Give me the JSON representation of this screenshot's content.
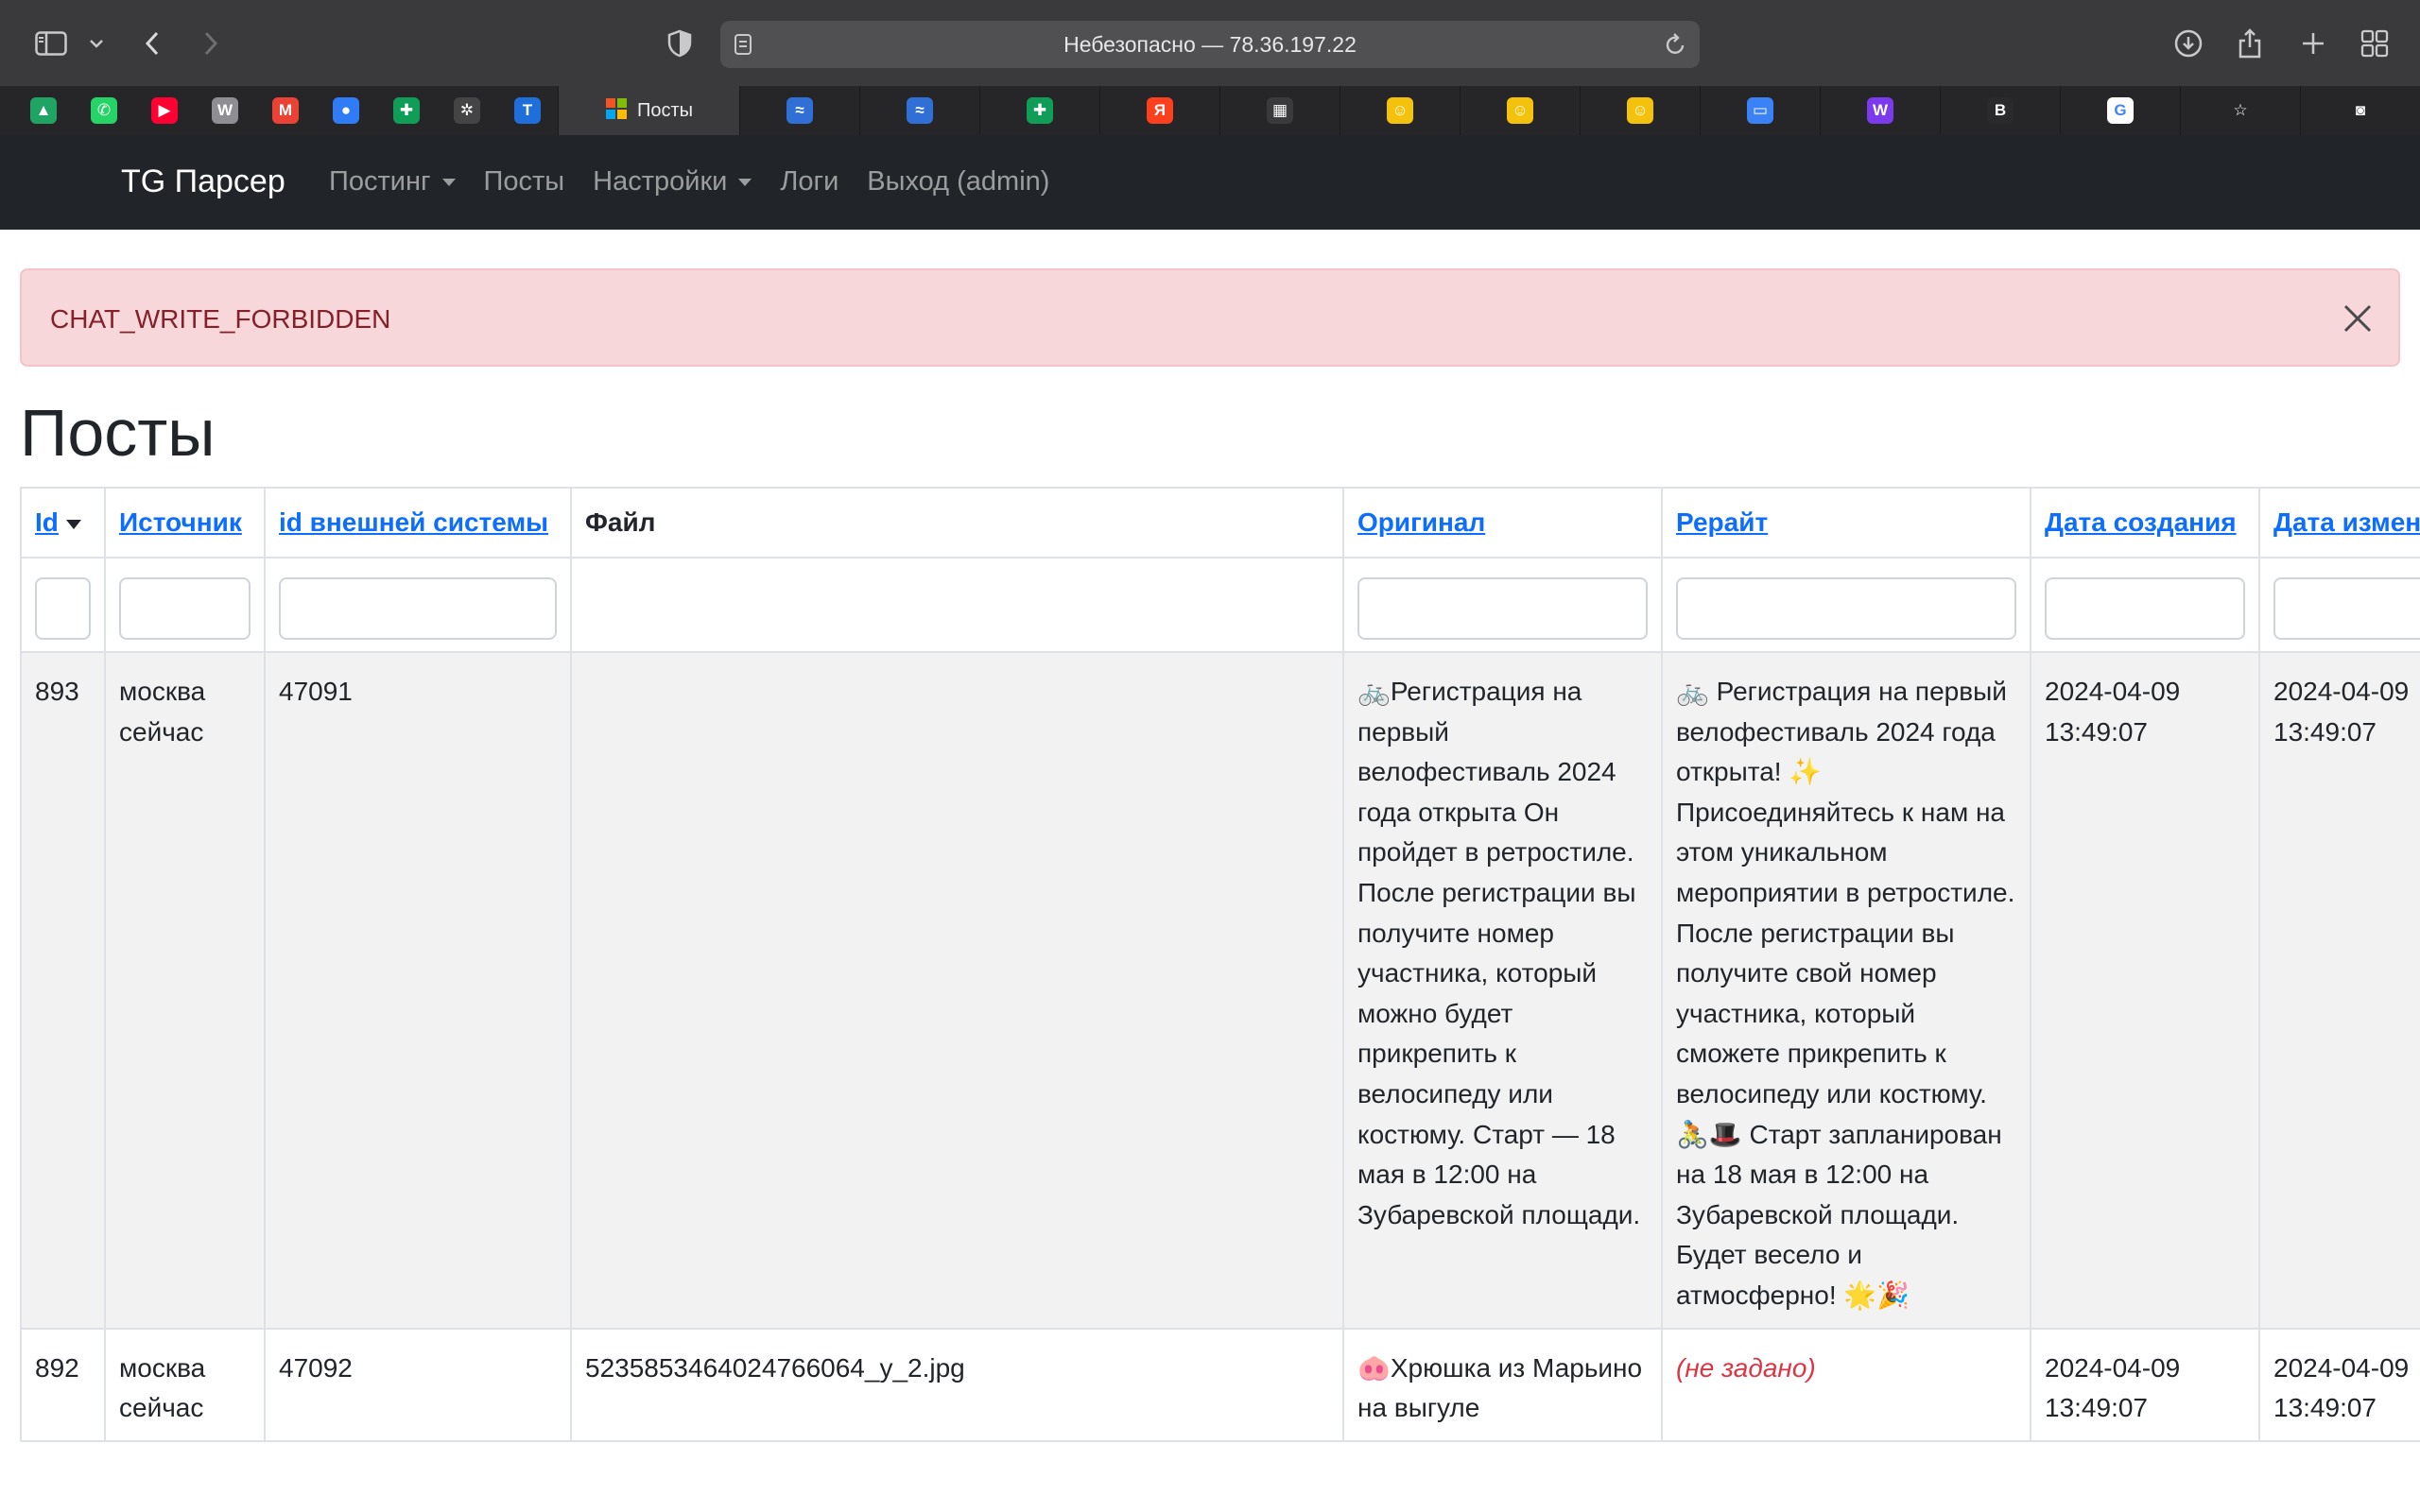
{
  "browser": {
    "url": "Небезопасно — 78.36.197.22",
    "active_tab_title": "Посты",
    "pinned_tabs": [
      {
        "icon": "google-drive-icon",
        "color": "#1fa463",
        "glyph": "▲"
      },
      {
        "icon": "whatsapp-icon",
        "color": "#25d366",
        "glyph": "✆"
      },
      {
        "icon": "youtube-icon",
        "color": "#ff0033",
        "glyph": "▶"
      },
      {
        "icon": "wiki-icon",
        "color": "#8e8e93",
        "glyph": "W"
      },
      {
        "icon": "gmail-icon",
        "color": "#ea4335",
        "glyph": "M"
      },
      {
        "icon": "blue-circle-icon",
        "color": "#2f7cf6",
        "glyph": "●"
      },
      {
        "icon": "sheets-icon",
        "color": "#0f9d58",
        "glyph": "✚"
      },
      {
        "icon": "chatgpt-icon",
        "color": "#444444",
        "glyph": "✲"
      },
      {
        "icon": "t-icon",
        "color": "#1e6fd9",
        "glyph": "T"
      }
    ],
    "tabs": [
      {
        "icon": "cloud-icon",
        "color": "#2f6fd6",
        "glyph": "≈"
      },
      {
        "icon": "cloud-icon",
        "color": "#2f6fd6",
        "glyph": "≈"
      },
      {
        "icon": "sheets-icon",
        "color": "#0f9d58",
        "glyph": "✚"
      },
      {
        "icon": "yandex-icon",
        "color": "#fc3f1d",
        "glyph": "Я"
      },
      {
        "icon": "windows-icon",
        "color": "#3a3a3c",
        "glyph": "▦"
      },
      {
        "icon": "emoji-icon",
        "color": "#f4c20d",
        "glyph": "☺"
      },
      {
        "icon": "emoji-icon",
        "color": "#f4c20d",
        "glyph": "☺"
      },
      {
        "icon": "emoji-icon",
        "color": "#f4c20d",
        "glyph": "☺"
      },
      {
        "icon": "folder-icon",
        "color": "#3b82f6",
        "glyph": "▭"
      },
      {
        "icon": "w-icon",
        "color": "#7c3aed",
        "glyph": "W"
      },
      {
        "icon": "bai-icon",
        "color": "#2a2a2c",
        "glyph": "B"
      },
      {
        "icon": "google-icon",
        "color": "#ffffff",
        "glyph": "G"
      },
      {
        "icon": "star-icon",
        "color": "#262628",
        "glyph": "☆"
      },
      {
        "icon": "camera-icon",
        "color": "#262628",
        "glyph": "◙"
      }
    ]
  },
  "navbar": {
    "brand": "TG Парсер",
    "items": [
      {
        "label": "Постинг",
        "dropdown": true
      },
      {
        "label": "Посты",
        "dropdown": false
      },
      {
        "label": "Настройки",
        "dropdown": true
      },
      {
        "label": "Логи",
        "dropdown": false
      },
      {
        "label": "Выход (admin)",
        "dropdown": false
      }
    ]
  },
  "alert": {
    "text": "CHAT_WRITE_FORBIDDEN"
  },
  "page": {
    "title": "Посты"
  },
  "table": {
    "columns": [
      {
        "label": "Id",
        "link": true,
        "sorted": true
      },
      {
        "label": "Источник",
        "link": true
      },
      {
        "label": "id внешней системы",
        "link": true
      },
      {
        "label": "Файл",
        "link": false
      },
      {
        "label": "Оригинал",
        "link": true
      },
      {
        "label": "Рерайт",
        "link": true
      },
      {
        "label": "Дата создания",
        "link": true
      },
      {
        "label": "Дата изменения",
        "link": true
      }
    ],
    "rows": [
      {
        "id": "893",
        "source": "москва сейчас",
        "external_id": "47091",
        "file": "",
        "original": "🚲Регистрация на первый велофестиваль 2024 года открыта Он пройдет в ретростиле. После регистрации вы получите номер участника, который можно будет прикрепить к велосипеду или костюму. Старт — 18 мая в 12:00 на Зубаревской площади.",
        "rewrite": "🚲 Регистрация на первый велофестиваль 2024 года открыта! ✨ Присоединяйтесь к нам на этом уникальном мероприятии в ретростиле. После регистрации вы получите свой номер участника, который сможете прикрепить к велосипеду или костюму. 🚴🎩 Старт запланирован на 18 мая в 12:00 на Зубаревской площади. Будет весело и атмосферно! 🌟🎉",
        "created": "2024-04-09 13:49:07",
        "updated": "2024-04-09 13:49:07"
      },
      {
        "id": "892",
        "source": "москва сейчас",
        "external_id": "47092",
        "file": "5235853464024766064_y_2.jpg",
        "original": "🐽Хрюшка из Марьино на выгуле",
        "rewrite": "(не задано)",
        "created": "2024-04-09 13:49:07",
        "updated": "2024-04-09 13:49:07"
      }
    ]
  }
}
